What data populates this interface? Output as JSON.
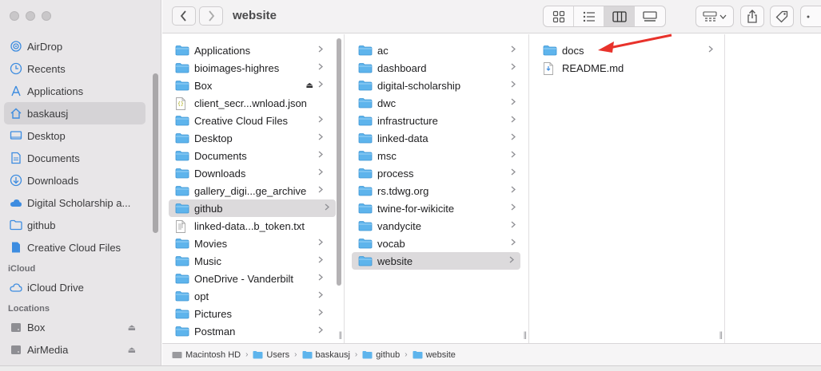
{
  "window": {
    "title": "website"
  },
  "sidebar": {
    "favorites": [
      {
        "label": "AirDrop",
        "icon": "airdrop-icon"
      },
      {
        "label": "Recents",
        "icon": "clock-icon"
      },
      {
        "label": "Applications",
        "icon": "applications-icon"
      },
      {
        "label": "baskausj",
        "icon": "home-icon",
        "selected": true
      },
      {
        "label": "Desktop",
        "icon": "desktop-icon"
      },
      {
        "label": "Documents",
        "icon": "document-icon"
      },
      {
        "label": "Downloads",
        "icon": "download-icon"
      },
      {
        "label": "Digital Scholarship a...",
        "icon": "cloud-icon"
      },
      {
        "label": "github",
        "icon": "folder-icon"
      },
      {
        "label": "Creative Cloud Files",
        "icon": "file-icon"
      }
    ],
    "icloud_heading": "iCloud",
    "icloud": [
      {
        "label": "iCloud Drive",
        "icon": "icloud-icon"
      }
    ],
    "locations_heading": "Locations",
    "locations": [
      {
        "label": "Box",
        "icon": "drive-icon",
        "eject": true
      },
      {
        "label": "AirMedia",
        "icon": "drive-icon",
        "eject": true
      }
    ]
  },
  "columns": {
    "col1": [
      {
        "label": "Applications",
        "type": "folder",
        "chevron": true
      },
      {
        "label": "bioimages-highres",
        "type": "folder",
        "chevron": true
      },
      {
        "label": "Box",
        "type": "folder",
        "chevron": true,
        "eject": true
      },
      {
        "label": "client_secr...wnload.json",
        "type": "json"
      },
      {
        "label": "Creative Cloud Files",
        "type": "folder",
        "chevron": true
      },
      {
        "label": "Desktop",
        "type": "folder",
        "chevron": true
      },
      {
        "label": "Documents",
        "type": "folder",
        "chevron": true
      },
      {
        "label": "Downloads",
        "type": "folder",
        "chevron": true
      },
      {
        "label": "gallery_digi...ge_archive",
        "type": "folder",
        "chevron": true
      },
      {
        "label": "github",
        "type": "folder",
        "chevron": true,
        "selected": true
      },
      {
        "label": "linked-data...b_token.txt",
        "type": "text"
      },
      {
        "label": "Movies",
        "type": "folder",
        "chevron": true
      },
      {
        "label": "Music",
        "type": "folder",
        "chevron": true
      },
      {
        "label": "OneDrive - Vanderbilt",
        "type": "folder",
        "chevron": true
      },
      {
        "label": "opt",
        "type": "folder",
        "chevron": true
      },
      {
        "label": "Pictures",
        "type": "folder",
        "chevron": true
      },
      {
        "label": "Postman",
        "type": "folder",
        "chevron": true
      }
    ],
    "col2": [
      {
        "label": "ac",
        "type": "folder",
        "chevron": true
      },
      {
        "label": "dashboard",
        "type": "folder",
        "chevron": true
      },
      {
        "label": "digital-scholarship",
        "type": "folder",
        "chevron": true
      },
      {
        "label": "dwc",
        "type": "folder",
        "chevron": true
      },
      {
        "label": "infrastructure",
        "type": "folder",
        "chevron": true
      },
      {
        "label": "linked-data",
        "type": "folder",
        "chevron": true
      },
      {
        "label": "msc",
        "type": "folder",
        "chevron": true
      },
      {
        "label": "process",
        "type": "folder",
        "chevron": true
      },
      {
        "label": "rs.tdwg.org",
        "type": "folder",
        "chevron": true
      },
      {
        "label": "twine-for-wikicite",
        "type": "folder",
        "chevron": true
      },
      {
        "label": "vandycite",
        "type": "folder",
        "chevron": true
      },
      {
        "label": "vocab",
        "type": "folder",
        "chevron": true
      },
      {
        "label": "website",
        "type": "folder",
        "chevron": true,
        "selected": true
      }
    ],
    "col3": [
      {
        "label": "docs",
        "type": "folder",
        "chevron": true
      },
      {
        "label": "README.md",
        "type": "markdown"
      }
    ]
  },
  "pathbar": [
    {
      "label": "Macintosh HD",
      "icon": "drive-icon"
    },
    {
      "label": "Users",
      "icon": "folder-icon"
    },
    {
      "label": "baskausj",
      "icon": "folder-icon"
    },
    {
      "label": "github",
      "icon": "folder-icon"
    },
    {
      "label": "website",
      "icon": "folder-icon"
    }
  ],
  "colors": {
    "folder": "#5eb4ec",
    "accent": "#e8322b",
    "selection": "#dcdadc"
  }
}
